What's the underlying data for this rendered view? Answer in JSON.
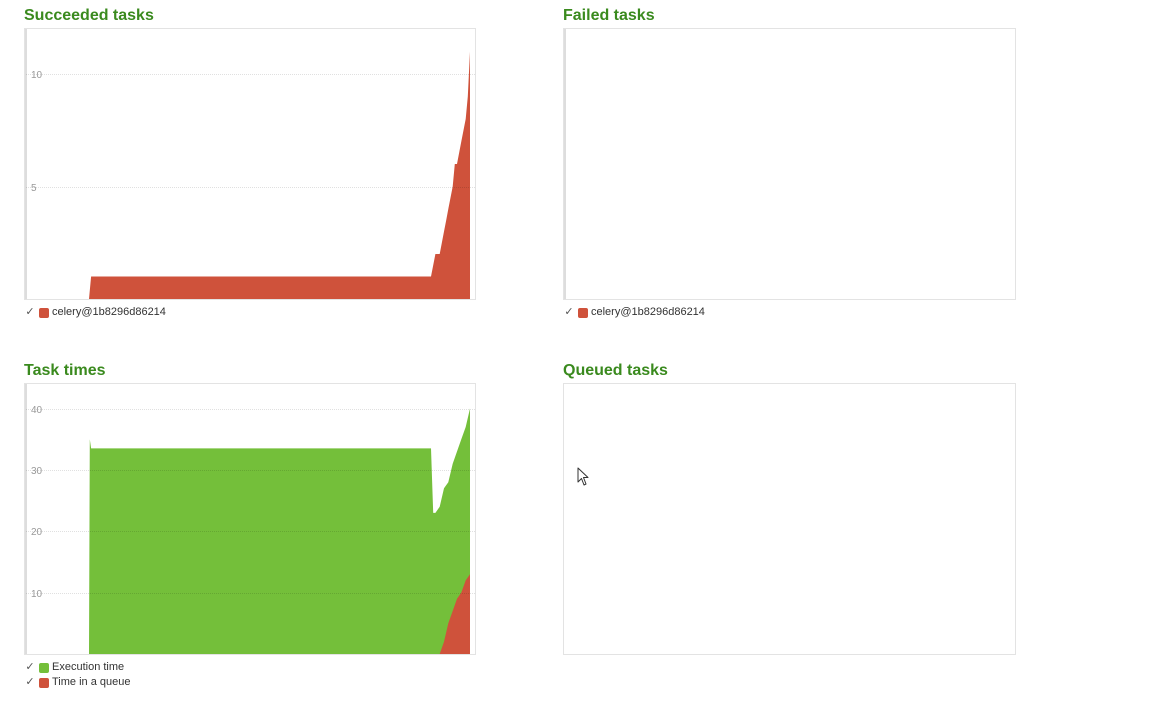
{
  "colors": {
    "title": "#3a8a1e",
    "worker": "#cf523b",
    "execution": "#74bf3a",
    "queue": "#cf523b",
    "grid": "#d9d9d9",
    "border": "#e3e3e3"
  },
  "panels": {
    "succeeded": {
      "title": "Succeeded tasks",
      "legend": [
        {
          "label": "celery@1b8296d86214",
          "color": "#cf523b",
          "checked": "✓"
        }
      ]
    },
    "failed": {
      "title": "Failed tasks",
      "legend": [
        {
          "label": "celery@1b8296d86214",
          "color": "#cf523b",
          "checked": "✓"
        }
      ]
    },
    "task_times": {
      "title": "Task times",
      "legend": [
        {
          "label": "Execution time",
          "color": "#74bf3a",
          "checked": "✓"
        },
        {
          "label": "Time in a queue",
          "color": "#cf523b",
          "checked": "✓"
        }
      ]
    },
    "queued": {
      "title": "Queued tasks"
    }
  },
  "chart_data": [
    {
      "type": "area",
      "title": "Succeeded tasks",
      "ylim": [
        0,
        12
      ],
      "yticks": [
        5,
        10
      ],
      "grid": true,
      "legend_position": "bottom-left",
      "x": [
        0,
        12,
        12.5,
        91,
        92,
        93,
        94,
        94.5,
        95,
        96,
        96.5,
        97,
        98,
        99,
        99.5,
        100
      ],
      "series": [
        {
          "name": "celery@1b8296d86214",
          "values": [
            0,
            0,
            1,
            1,
            2,
            2,
            3,
            3.5,
            4,
            5,
            6,
            6,
            7,
            8,
            9,
            11
          ]
        }
      ]
    },
    {
      "type": "area",
      "title": "Failed tasks",
      "grid": false,
      "legend_position": "bottom-left",
      "series": [
        {
          "name": "celery@1b8296d86214",
          "values": []
        }
      ]
    },
    {
      "type": "area",
      "title": "Task times",
      "ylim": [
        0,
        44
      ],
      "yticks": [
        10,
        20,
        30,
        40
      ],
      "grid": true,
      "legend_position": "bottom-left",
      "x": [
        0,
        12,
        12.2,
        12.5,
        91,
        91.5,
        92,
        93,
        94,
        95,
        96,
        97,
        98,
        99,
        100
      ],
      "series": [
        {
          "name": "Execution time",
          "values": [
            0,
            0,
            35,
            33.5,
            33.5,
            23,
            23,
            24,
            27,
            28,
            31,
            33,
            35,
            37,
            40
          ]
        },
        {
          "name": "Time in a queue",
          "x": [
            0,
            93,
            94,
            95,
            96,
            97,
            98,
            99,
            100
          ],
          "values": [
            0,
            0,
            2,
            5,
            7,
            9,
            10,
            12,
            13
          ]
        }
      ]
    },
    {
      "type": "area",
      "title": "Queued tasks",
      "grid": false,
      "series": []
    }
  ]
}
